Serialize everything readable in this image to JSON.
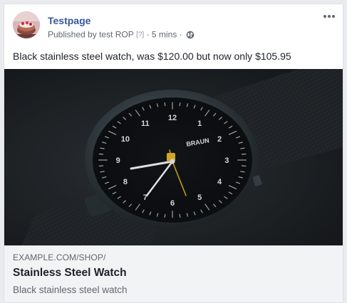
{
  "post": {
    "page_name": "Testpage",
    "published_by_label": "Published by",
    "publisher_name": "test ROP",
    "help_marker": "[?]",
    "separator": "·",
    "time_ago": "5 mins",
    "privacy_icon": "globe-icon",
    "more_icon": "more-horizontal-icon",
    "message": "Black stainless steel watch, was $120.00 but now only $105.95"
  },
  "link_preview": {
    "image_icon": "watch-photo",
    "watch_brand": "BRAUN",
    "dial_numbers": [
      "12",
      "1",
      "2",
      "3",
      "4",
      "5",
      "6",
      "7",
      "8",
      "9",
      "10",
      "11"
    ],
    "domain": "EXAMPLE.COM/SHOP/",
    "title": "Stainless Steel Watch",
    "description": "Black stainless steel watch"
  },
  "colors": {
    "link_blue": "#365899",
    "meta_gray": "#616770",
    "text_dark": "#1d2129",
    "preview_bg": "#f2f3f5",
    "second_hand": "#d6a520"
  }
}
